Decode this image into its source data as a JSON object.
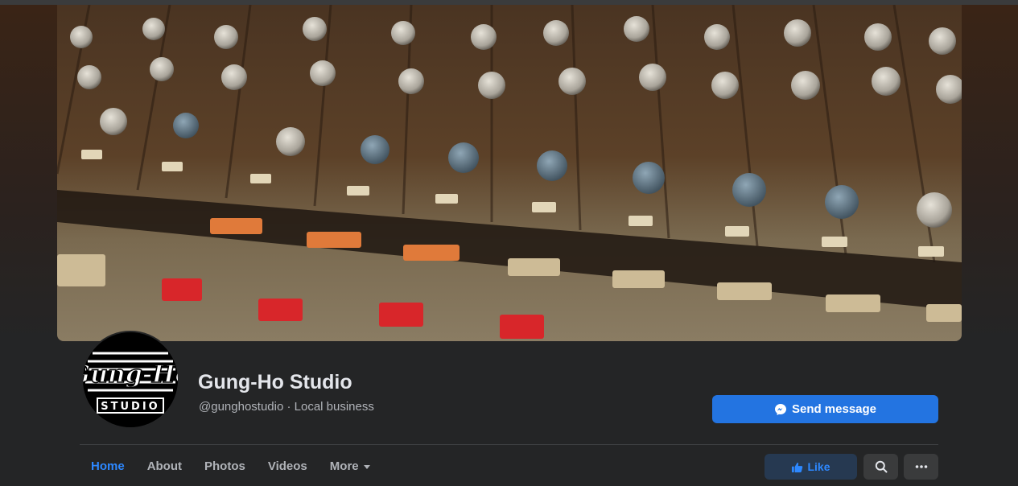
{
  "page": {
    "name": "Gung-Ho Studio",
    "handle": "@gunghostudio · Local business",
    "avatar_text_top": "Gung-Ho",
    "avatar_text_bottom": "STUDIO"
  },
  "actions": {
    "send_message": "Send message",
    "like": "Like"
  },
  "tabs": [
    {
      "label": "Home",
      "active": true
    },
    {
      "label": "About",
      "active": false
    },
    {
      "label": "Photos",
      "active": false
    },
    {
      "label": "Videos",
      "active": false
    },
    {
      "label": "More",
      "active": false
    }
  ],
  "icons": {
    "send": "messenger-icon",
    "like": "thumbs-up-icon",
    "search": "search-icon",
    "more": "ellipsis-icon",
    "tab_more": "caret-down-icon"
  },
  "colors": {
    "accent": "#2374e1",
    "active_tab": "#2d88ff",
    "background": "#242526"
  }
}
